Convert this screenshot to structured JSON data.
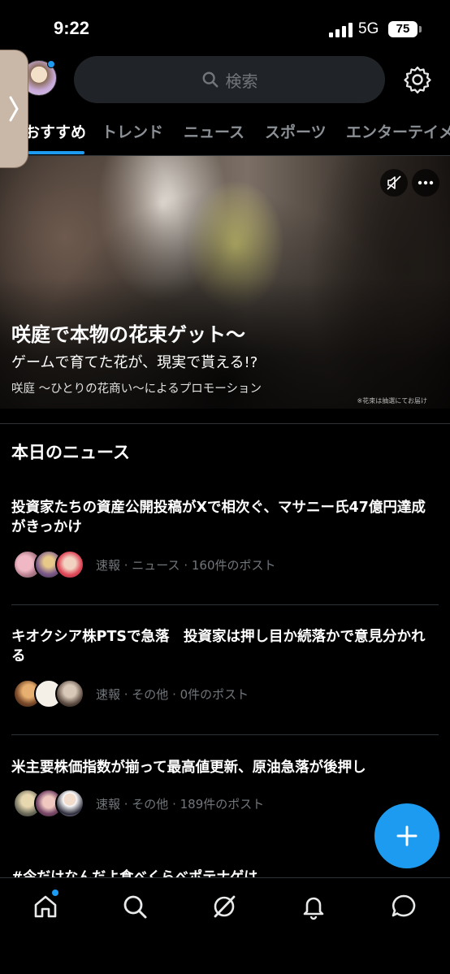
{
  "status_bar": {
    "time": "9:22",
    "network": "5G",
    "battery": "75"
  },
  "search": {
    "placeholder": "検索"
  },
  "tabs": [
    {
      "label": "おすすめ",
      "active": true
    },
    {
      "label": "トレンド"
    },
    {
      "label": "ニュース"
    },
    {
      "label": "スポーツ"
    },
    {
      "label": "エンターテイメ"
    }
  ],
  "promo": {
    "title": "咲庭で本物の花束ゲット～",
    "subtitle": "ゲームで育てた花が、現実で貰える!?",
    "sponsor": "咲庭 ～ひとりの花商い～によるプロモーション",
    "note": "※花束は抽選にてお届け"
  },
  "news": {
    "section_title": "本日のニュース",
    "items": [
      {
        "headline": "投資家たちの資産公開投稿がXで相次ぐ、マサニー氏47億円達成がきっかけ",
        "meta": "速報 · ニュース · 160件のポスト"
      },
      {
        "headline": "キオクシア株PTSで急落　投資家は押し目か続落かで意見分かれる",
        "meta": "速報 · その他 · 0件のポスト"
      },
      {
        "headline": "米主要株価指数が揃って最高値更新、原油急落が後押し",
        "meta": "速報 · その他 · 189件のポスト"
      }
    ],
    "peek_text": "#今だけなんだよ食べくらべポテナゲは"
  },
  "colors": {
    "accent": "#1d9bf0",
    "background": "#000000",
    "divider": "#2f3336",
    "muted": "#71767b"
  },
  "icons": [
    "search-icon",
    "gear-icon",
    "mute-icon",
    "more-icon",
    "plus-icon",
    "home-icon",
    "grok-icon",
    "bell-icon",
    "message-icon"
  ]
}
